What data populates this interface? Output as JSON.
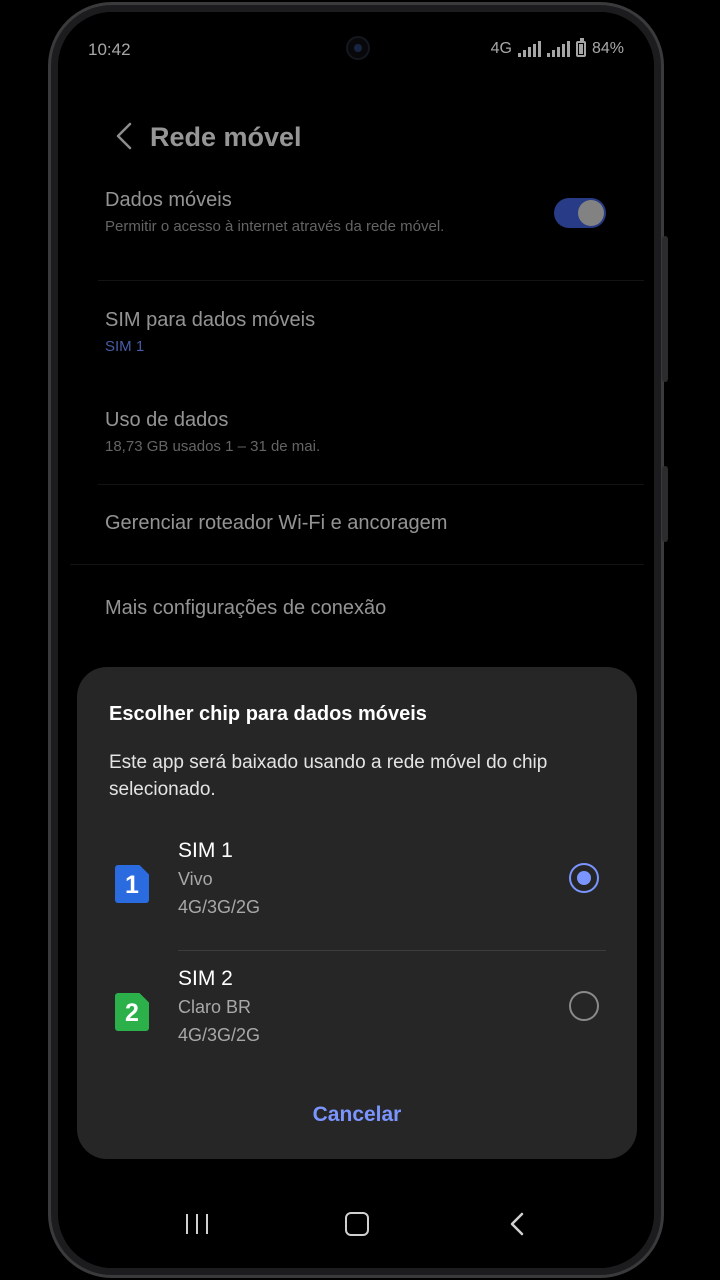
{
  "status_bar": {
    "time": "10:42",
    "network": "4G",
    "battery": "84%"
  },
  "header": {
    "title": "Rede móvel",
    "back_icon": "chevron-left-icon"
  },
  "settings": {
    "mobile_data": {
      "title": "Dados móveis",
      "subtitle": "Permitir o acesso à internet através da rede móvel.",
      "enabled": true
    },
    "sim_for_data": {
      "title": "SIM para dados móveis",
      "value": "SIM 1"
    },
    "data_usage": {
      "title": "Uso de dados",
      "subtitle": "18,73 GB usados  1 – 31 de mai."
    },
    "hotspot": {
      "title": "Gerenciar roteador Wi-Fi e ancoragem"
    },
    "more": {
      "title": "Mais configurações de conexão"
    }
  },
  "dialog": {
    "title": "Escolher chip para dados móveis",
    "message": "Este app será baixado usando a rede móvel do chip selecionado.",
    "options": [
      {
        "badge": "1",
        "name": "SIM 1",
        "carrier": "Vivo",
        "network": "4G/3G/2G",
        "selected": true,
        "color": "#2b6be0"
      },
      {
        "badge": "2",
        "name": "SIM 2",
        "carrier": "Claro BR",
        "network": "4G/3G/2G",
        "selected": false,
        "color": "#2bb04a"
      }
    ],
    "cancel_label": "Cancelar"
  },
  "colors": {
    "accent": "#7b95ff",
    "toggle_on": "#3e5bd0",
    "dialog_bg": "#262626"
  }
}
